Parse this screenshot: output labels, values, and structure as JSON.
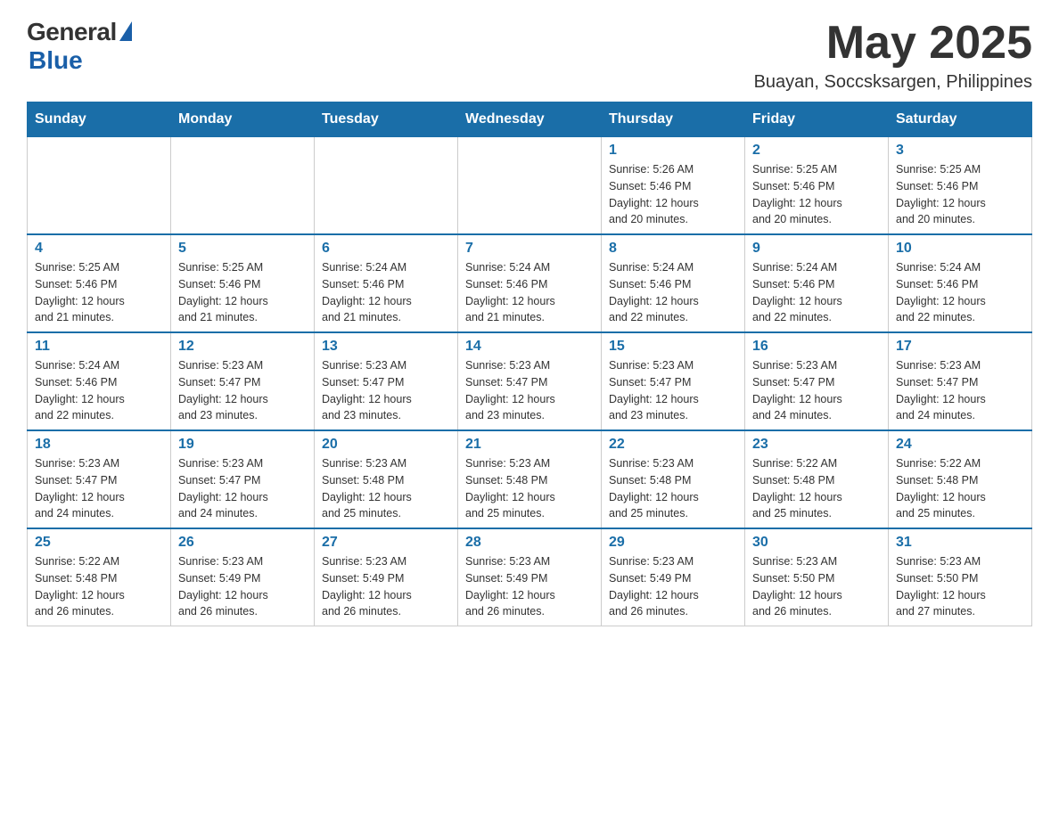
{
  "header": {
    "logo_general": "General",
    "logo_blue": "Blue",
    "month_year": "May 2025",
    "location": "Buayan, Soccsksargen, Philippines"
  },
  "weekdays": [
    "Sunday",
    "Monday",
    "Tuesday",
    "Wednesday",
    "Thursday",
    "Friday",
    "Saturday"
  ],
  "weeks": [
    [
      {
        "day": "",
        "info": ""
      },
      {
        "day": "",
        "info": ""
      },
      {
        "day": "",
        "info": ""
      },
      {
        "day": "",
        "info": ""
      },
      {
        "day": "1",
        "info": "Sunrise: 5:26 AM\nSunset: 5:46 PM\nDaylight: 12 hours\nand 20 minutes."
      },
      {
        "day": "2",
        "info": "Sunrise: 5:25 AM\nSunset: 5:46 PM\nDaylight: 12 hours\nand 20 minutes."
      },
      {
        "day": "3",
        "info": "Sunrise: 5:25 AM\nSunset: 5:46 PM\nDaylight: 12 hours\nand 20 minutes."
      }
    ],
    [
      {
        "day": "4",
        "info": "Sunrise: 5:25 AM\nSunset: 5:46 PM\nDaylight: 12 hours\nand 21 minutes."
      },
      {
        "day": "5",
        "info": "Sunrise: 5:25 AM\nSunset: 5:46 PM\nDaylight: 12 hours\nand 21 minutes."
      },
      {
        "day": "6",
        "info": "Sunrise: 5:24 AM\nSunset: 5:46 PM\nDaylight: 12 hours\nand 21 minutes."
      },
      {
        "day": "7",
        "info": "Sunrise: 5:24 AM\nSunset: 5:46 PM\nDaylight: 12 hours\nand 21 minutes."
      },
      {
        "day": "8",
        "info": "Sunrise: 5:24 AM\nSunset: 5:46 PM\nDaylight: 12 hours\nand 22 minutes."
      },
      {
        "day": "9",
        "info": "Sunrise: 5:24 AM\nSunset: 5:46 PM\nDaylight: 12 hours\nand 22 minutes."
      },
      {
        "day": "10",
        "info": "Sunrise: 5:24 AM\nSunset: 5:46 PM\nDaylight: 12 hours\nand 22 minutes."
      }
    ],
    [
      {
        "day": "11",
        "info": "Sunrise: 5:24 AM\nSunset: 5:46 PM\nDaylight: 12 hours\nand 22 minutes."
      },
      {
        "day": "12",
        "info": "Sunrise: 5:23 AM\nSunset: 5:47 PM\nDaylight: 12 hours\nand 23 minutes."
      },
      {
        "day": "13",
        "info": "Sunrise: 5:23 AM\nSunset: 5:47 PM\nDaylight: 12 hours\nand 23 minutes."
      },
      {
        "day": "14",
        "info": "Sunrise: 5:23 AM\nSunset: 5:47 PM\nDaylight: 12 hours\nand 23 minutes."
      },
      {
        "day": "15",
        "info": "Sunrise: 5:23 AM\nSunset: 5:47 PM\nDaylight: 12 hours\nand 23 minutes."
      },
      {
        "day": "16",
        "info": "Sunrise: 5:23 AM\nSunset: 5:47 PM\nDaylight: 12 hours\nand 24 minutes."
      },
      {
        "day": "17",
        "info": "Sunrise: 5:23 AM\nSunset: 5:47 PM\nDaylight: 12 hours\nand 24 minutes."
      }
    ],
    [
      {
        "day": "18",
        "info": "Sunrise: 5:23 AM\nSunset: 5:47 PM\nDaylight: 12 hours\nand 24 minutes."
      },
      {
        "day": "19",
        "info": "Sunrise: 5:23 AM\nSunset: 5:47 PM\nDaylight: 12 hours\nand 24 minutes."
      },
      {
        "day": "20",
        "info": "Sunrise: 5:23 AM\nSunset: 5:48 PM\nDaylight: 12 hours\nand 25 minutes."
      },
      {
        "day": "21",
        "info": "Sunrise: 5:23 AM\nSunset: 5:48 PM\nDaylight: 12 hours\nand 25 minutes."
      },
      {
        "day": "22",
        "info": "Sunrise: 5:23 AM\nSunset: 5:48 PM\nDaylight: 12 hours\nand 25 minutes."
      },
      {
        "day": "23",
        "info": "Sunrise: 5:22 AM\nSunset: 5:48 PM\nDaylight: 12 hours\nand 25 minutes."
      },
      {
        "day": "24",
        "info": "Sunrise: 5:22 AM\nSunset: 5:48 PM\nDaylight: 12 hours\nand 25 minutes."
      }
    ],
    [
      {
        "day": "25",
        "info": "Sunrise: 5:22 AM\nSunset: 5:48 PM\nDaylight: 12 hours\nand 26 minutes."
      },
      {
        "day": "26",
        "info": "Sunrise: 5:23 AM\nSunset: 5:49 PM\nDaylight: 12 hours\nand 26 minutes."
      },
      {
        "day": "27",
        "info": "Sunrise: 5:23 AM\nSunset: 5:49 PM\nDaylight: 12 hours\nand 26 minutes."
      },
      {
        "day": "28",
        "info": "Sunrise: 5:23 AM\nSunset: 5:49 PM\nDaylight: 12 hours\nand 26 minutes."
      },
      {
        "day": "29",
        "info": "Sunrise: 5:23 AM\nSunset: 5:49 PM\nDaylight: 12 hours\nand 26 minutes."
      },
      {
        "day": "30",
        "info": "Sunrise: 5:23 AM\nSunset: 5:50 PM\nDaylight: 12 hours\nand 26 minutes."
      },
      {
        "day": "31",
        "info": "Sunrise: 5:23 AM\nSunset: 5:50 PM\nDaylight: 12 hours\nand 27 minutes."
      }
    ]
  ]
}
